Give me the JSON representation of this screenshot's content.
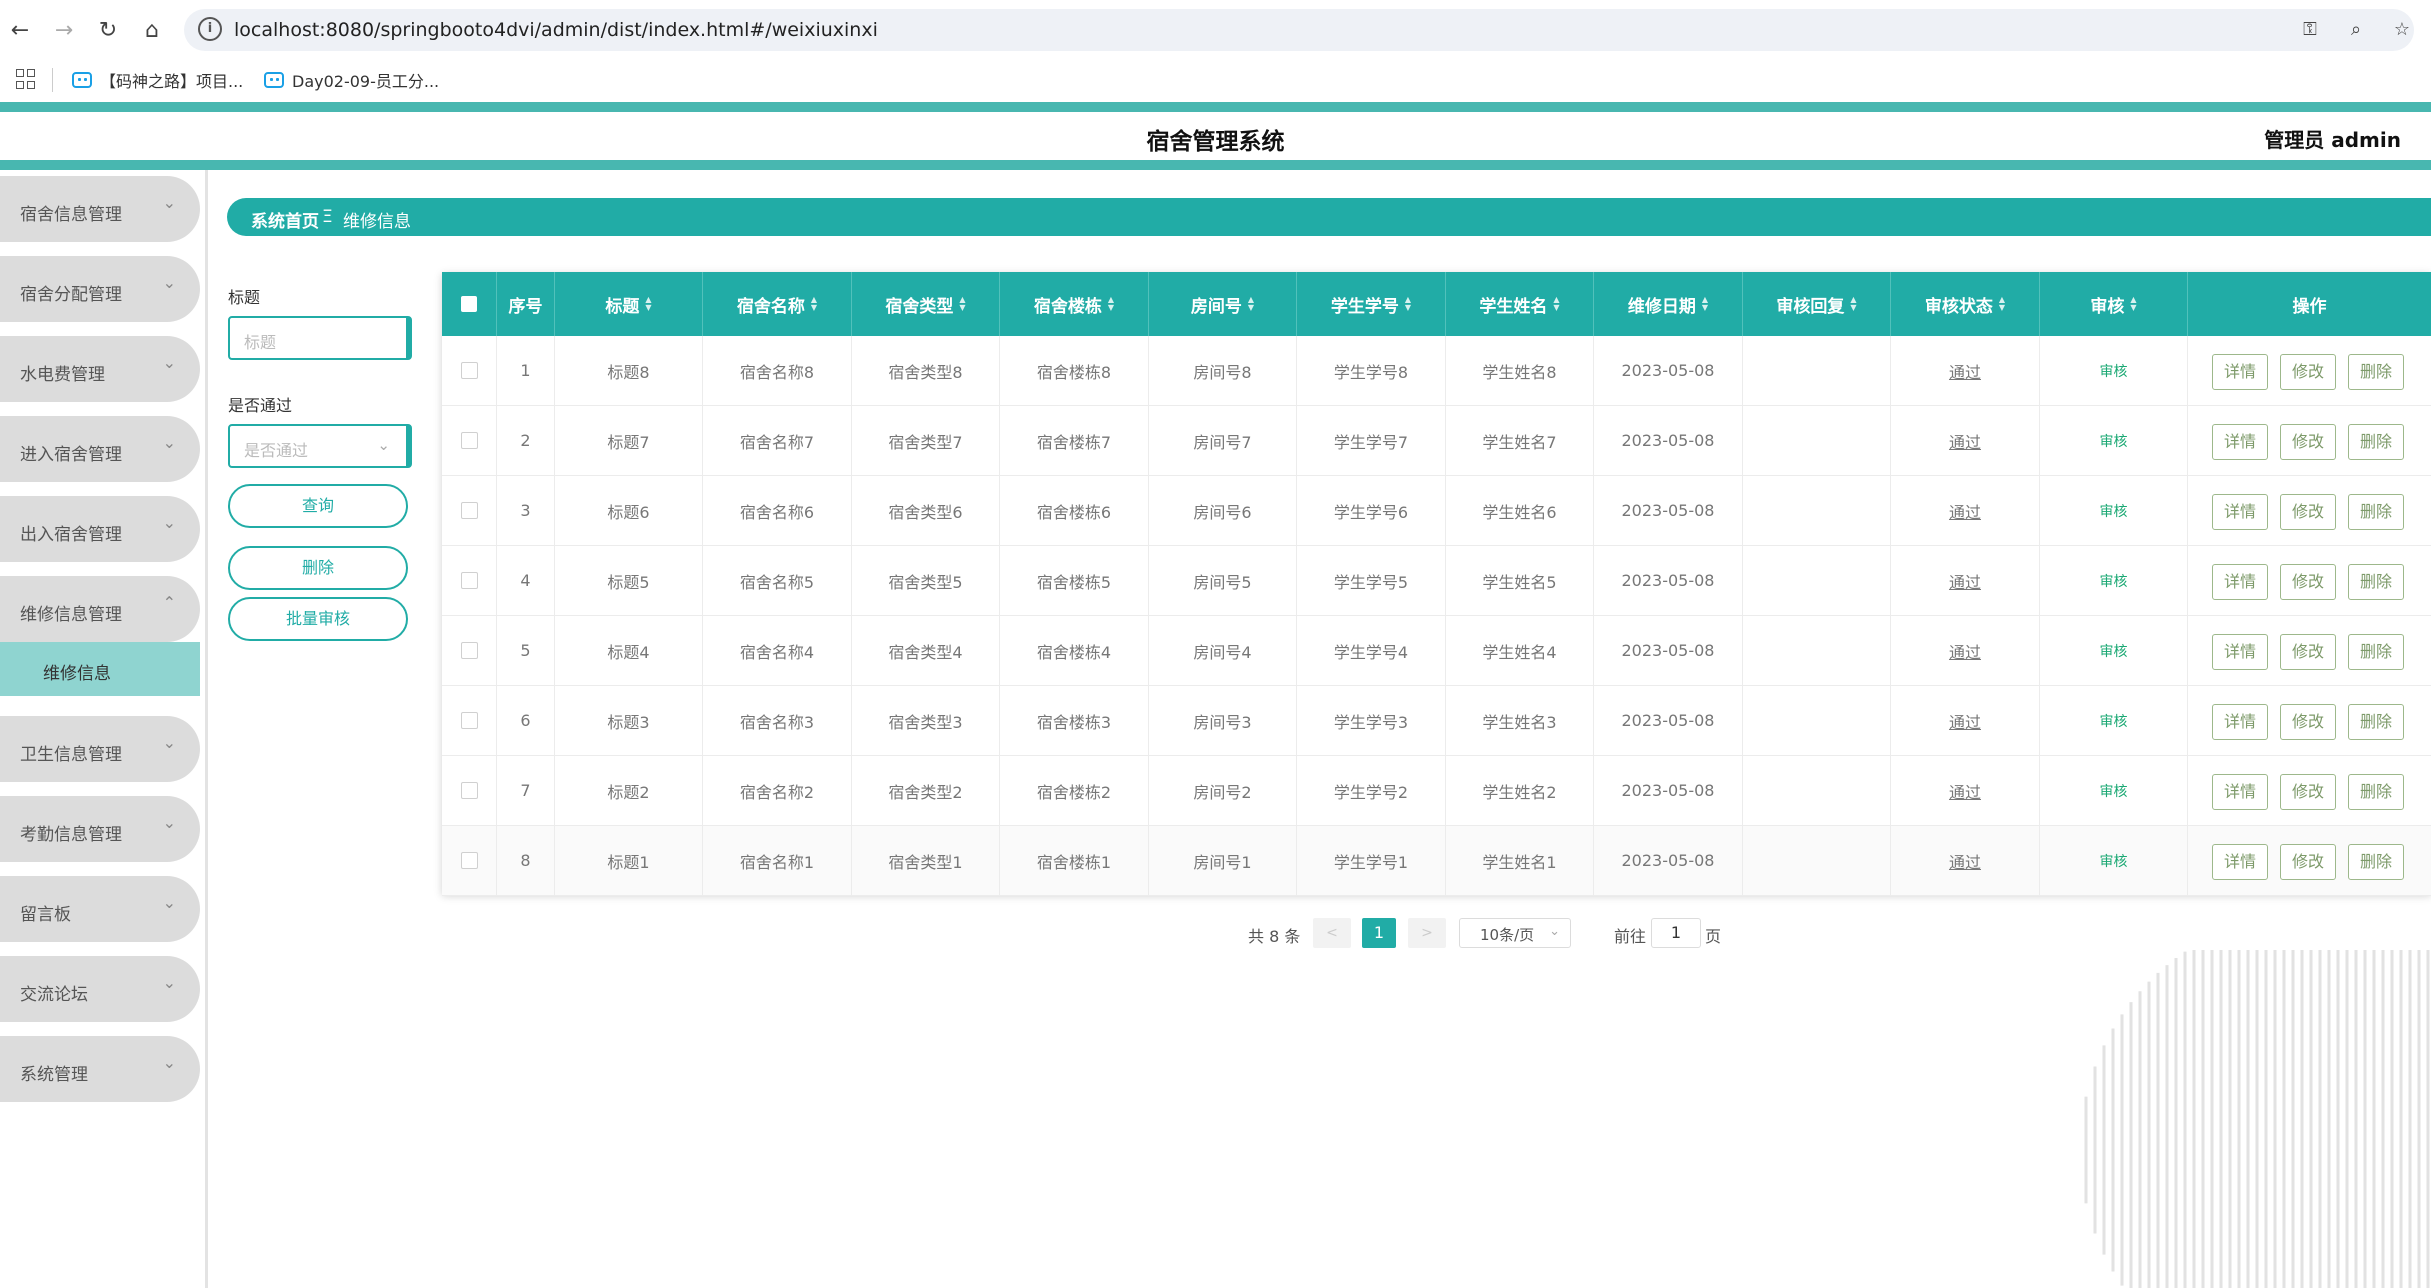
{
  "browser": {
    "url": "localhost:8080/springbooto4dvi/admin/dist/index.html#/weixiuxinxi",
    "bookmarks": [
      "【码神之路】项目...",
      "Day02-09-员工分..."
    ]
  },
  "header": {
    "title": "宿舍管理系统",
    "user": "管理员 admin"
  },
  "sidebar": {
    "items": [
      {
        "label": "宿舍信息管理",
        "chevron": "⌄"
      },
      {
        "label": "宿舍分配管理",
        "chevron": "⌄"
      },
      {
        "label": "水电费管理",
        "chevron": "⌄"
      },
      {
        "label": "进入宿舍管理",
        "chevron": "⌄"
      },
      {
        "label": "出入宿舍管理",
        "chevron": "⌄"
      },
      {
        "label": "维修信息管理",
        "chevron": "⌃"
      },
      {
        "label": "卫生信息管理",
        "chevron": "⌄"
      },
      {
        "label": "考勤信息管理",
        "chevron": "⌄"
      },
      {
        "label": "留言板",
        "chevron": "⌄"
      },
      {
        "label": "交流论坛",
        "chevron": "⌄"
      },
      {
        "label": "系统管理",
        "chevron": "⌄"
      }
    ],
    "active_sub": "维修信息"
  },
  "breadcrumb": {
    "home": "系统首页",
    "sep": "Ξ",
    "current": "维修信息"
  },
  "search": {
    "title_label": "标题",
    "title_placeholder": "标题",
    "pass_label": "是否通过",
    "pass_placeholder": "是否通过",
    "query_button": "查询",
    "delete_button": "删除",
    "batch_audit_button": "批量审核"
  },
  "table": {
    "columns": [
      "序号",
      "标题",
      "宿舍名称",
      "宿舍类型",
      "宿舍楼栋",
      "房间号",
      "学生学号",
      "学生姓名",
      "维修日期",
      "审核回复",
      "审核状态",
      "审核",
      "操作"
    ],
    "rows": [
      {
        "no": "1",
        "title": "标题8",
        "dorm_name": "宿舍名称8",
        "dorm_type": "宿舍类型8",
        "building": "宿舍楼栋8",
        "room": "房间号8",
        "student_no": "学生学号8",
        "student_name": "学生姓名8",
        "date": "2023-05-08",
        "reply": "",
        "status": "通过",
        "audit": "审核"
      },
      {
        "no": "2",
        "title": "标题7",
        "dorm_name": "宿舍名称7",
        "dorm_type": "宿舍类型7",
        "building": "宿舍楼栋7",
        "room": "房间号7",
        "student_no": "学生学号7",
        "student_name": "学生姓名7",
        "date": "2023-05-08",
        "reply": "",
        "status": "通过",
        "audit": "审核"
      },
      {
        "no": "3",
        "title": "标题6",
        "dorm_name": "宿舍名称6",
        "dorm_type": "宿舍类型6",
        "building": "宿舍楼栋6",
        "room": "房间号6",
        "student_no": "学生学号6",
        "student_name": "学生姓名6",
        "date": "2023-05-08",
        "reply": "",
        "status": "通过",
        "audit": "审核"
      },
      {
        "no": "4",
        "title": "标题5",
        "dorm_name": "宿舍名称5",
        "dorm_type": "宿舍类型5",
        "building": "宿舍楼栋5",
        "room": "房间号5",
        "student_no": "学生学号5",
        "student_name": "学生姓名5",
        "date": "2023-05-08",
        "reply": "",
        "status": "通过",
        "audit": "审核"
      },
      {
        "no": "5",
        "title": "标题4",
        "dorm_name": "宿舍名称4",
        "dorm_type": "宿舍类型4",
        "building": "宿舍楼栋4",
        "room": "房间号4",
        "student_no": "学生学号4",
        "student_name": "学生姓名4",
        "date": "2023-05-08",
        "reply": "",
        "status": "通过",
        "audit": "审核"
      },
      {
        "no": "6",
        "title": "标题3",
        "dorm_name": "宿舍名称3",
        "dorm_type": "宿舍类型3",
        "building": "宿舍楼栋3",
        "room": "房间号3",
        "student_no": "学生学号3",
        "student_name": "学生姓名3",
        "date": "2023-05-08",
        "reply": "",
        "status": "通过",
        "audit": "审核"
      },
      {
        "no": "7",
        "title": "标题2",
        "dorm_name": "宿舍名称2",
        "dorm_type": "宿舍类型2",
        "building": "宿舍楼栋2",
        "room": "房间号2",
        "student_no": "学生学号2",
        "student_name": "学生姓名2",
        "date": "2023-05-08",
        "reply": "",
        "status": "通过",
        "audit": "审核"
      },
      {
        "no": "8",
        "title": "标题1",
        "dorm_name": "宿舍名称1",
        "dorm_type": "宿舍类型1",
        "building": "宿舍楼栋1",
        "room": "房间号1",
        "student_no": "学生学号1",
        "student_name": "学生姓名1",
        "date": "2023-05-08",
        "reply": "",
        "status": "通过",
        "audit": "审核"
      }
    ],
    "actions": [
      "详情",
      "修改",
      "删除"
    ]
  },
  "pagination": {
    "total": "共 8 条",
    "prev": "<",
    "current": "1",
    "next": ">",
    "page_size": "10条/页",
    "goto_prefix": "前往",
    "goto_value": "1",
    "goto_suffix": "页"
  },
  "colors": {
    "accent": "#21aca6",
    "stripe": "#48b7b0",
    "active_sub_bg": "#8fd4d0",
    "audit_link": "#1aa873"
  }
}
